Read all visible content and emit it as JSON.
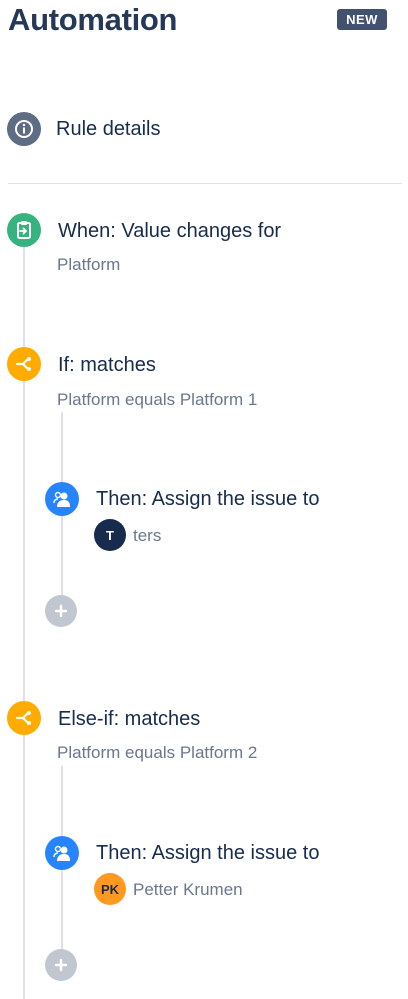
{
  "header": {
    "title": "Automation",
    "badge": "NEW"
  },
  "rule_details": {
    "label": "Rule details",
    "icon": "info-icon"
  },
  "trigger": {
    "label": "When: Value changes for",
    "detail": "Platform",
    "icon": "trigger-icon"
  },
  "branches": [
    {
      "label": "If: matches",
      "detail": "Platform equals Platform 1",
      "icon": "branch-icon",
      "action": {
        "label": "Then: Assign the issue to",
        "assignee_initials": "T",
        "assignee_name": "ters",
        "icon": "assign-user-icon"
      }
    },
    {
      "label": "Else-if: matches",
      "detail": "Platform equals Platform 2",
      "icon": "branch-icon",
      "action": {
        "label": "Then: Assign the issue to",
        "assignee_initials": "PK",
        "assignee_name": "Petter Krumen",
        "icon": "assign-user-icon"
      }
    }
  ],
  "colors": {
    "trigger": "#36b37e",
    "condition": "#ffab00",
    "action": "#2684ff",
    "neutral": "#5e6c84",
    "add": "#c1c7d0"
  }
}
